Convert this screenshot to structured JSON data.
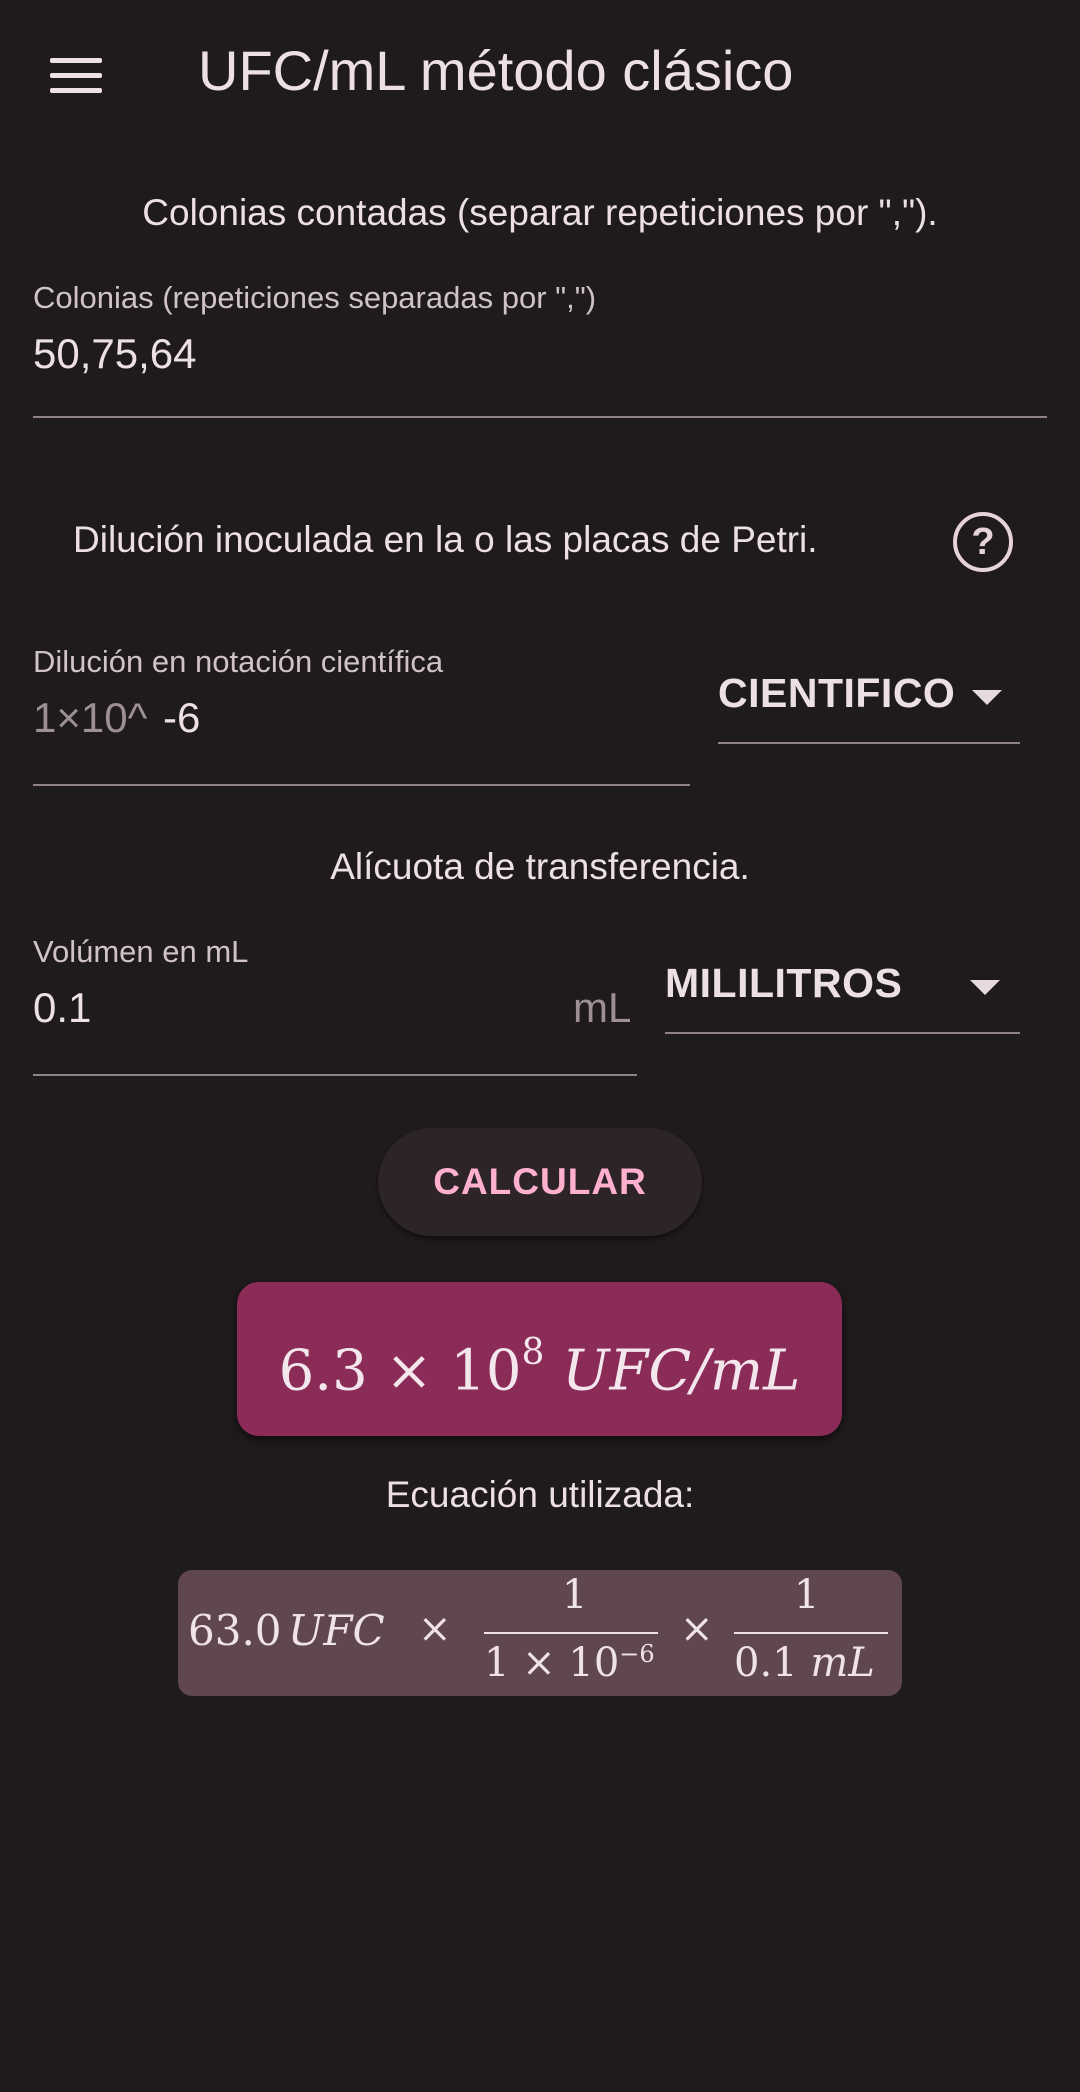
{
  "appbar": {
    "title": "UFC/mL método clásico",
    "menu_icon": "hamburger-menu-icon"
  },
  "colonies": {
    "section_label": "Colonias contadas (separar repeticiones por \",\").",
    "field_label": "Colonias (repeticiones separadas por \",\")",
    "value": "50,75,64"
  },
  "dilution": {
    "section_label": "Dilución inoculada en la o las placas de Petri.",
    "help_icon": "question-circle-icon",
    "field_label": "Dilución en notación científica",
    "prefix": "1×10^",
    "value": "-6",
    "unit_selected": "CIENTIFICO"
  },
  "aliquot": {
    "section_label": "Alícuota de transferencia.",
    "field_label": "Volúmen en mL",
    "value": "0.1",
    "suffix": "mL",
    "unit_selected": "MILILITROS"
  },
  "actions": {
    "calculate_label": "CALCULAR"
  },
  "result": {
    "mantissa": "6.3",
    "times": "×",
    "base": "10",
    "exponent": "8",
    "unit": "UFC/mL"
  },
  "equation": {
    "label": "Ecuación utilizada:",
    "count": "63.0",
    "count_unit": "UFC",
    "times": "×",
    "frac1_num": "1",
    "frac1_den_base": "1 × 10",
    "frac1_den_exp": "−6",
    "frac2_num": "1",
    "frac2_den_value": "0.1",
    "frac2_den_unit": "mL"
  },
  "colors": {
    "background": "#1f1a1c",
    "result_box": "#8b2b57",
    "equation_box": "#5f464f",
    "button_text": "#ffb0cf"
  }
}
